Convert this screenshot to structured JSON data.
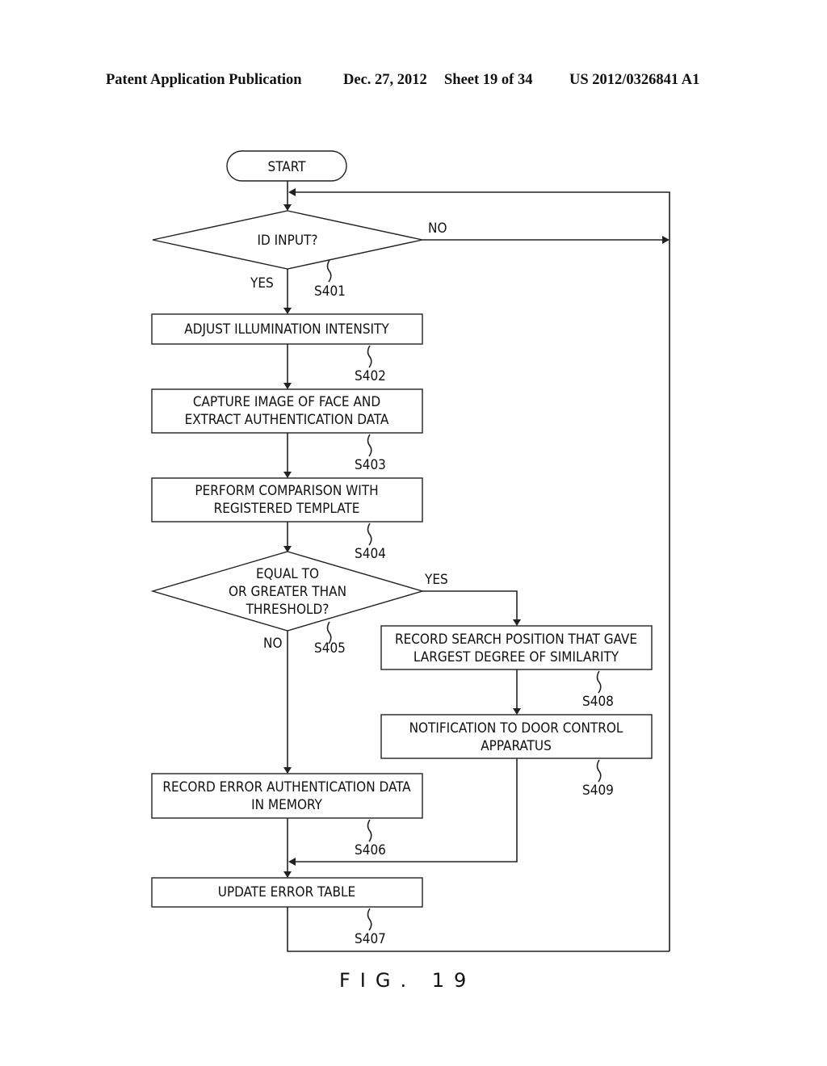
{
  "header": {
    "publication": "Patent Application Publication",
    "date": "Dec. 27, 2012",
    "sheet": "Sheet 19 of 34",
    "number": "US 2012/0326841 A1"
  },
  "flowchart": {
    "start": "START",
    "s401": {
      "lines": [
        "ID INPUT?"
      ],
      "ref": "S401",
      "yes": "YES",
      "no": "NO"
    },
    "s402": {
      "lines": [
        "ADJUST ILLUMINATION INTENSITY"
      ],
      "ref": "S402"
    },
    "s403": {
      "lines": [
        "CAPTURE IMAGE OF FACE AND",
        "EXTRACT AUTHENTICATION DATA"
      ],
      "ref": "S403"
    },
    "s404": {
      "lines": [
        "PERFORM COMPARISON WITH",
        "REGISTERED TEMPLATE"
      ],
      "ref": "S404"
    },
    "s405": {
      "lines": [
        "EQUAL TO",
        "OR GREATER THAN",
        "THRESHOLD?"
      ],
      "ref": "S405",
      "yes": "YES",
      "no": "NO"
    },
    "s406": {
      "lines": [
        "RECORD ERROR AUTHENTICATION DATA",
        "IN MEMORY"
      ],
      "ref": "S406"
    },
    "s407": {
      "lines": [
        "UPDATE ERROR TABLE"
      ],
      "ref": "S407"
    },
    "s408": {
      "lines": [
        "RECORD SEARCH POSITION THAT GAVE",
        "LARGEST DEGREE OF SIMILARITY"
      ],
      "ref": "S408"
    },
    "s409": {
      "lines": [
        "NOTIFICATION TO DOOR CONTROL",
        "APPARATUS"
      ],
      "ref": "S409"
    }
  },
  "figure_label": "FIG. 19"
}
